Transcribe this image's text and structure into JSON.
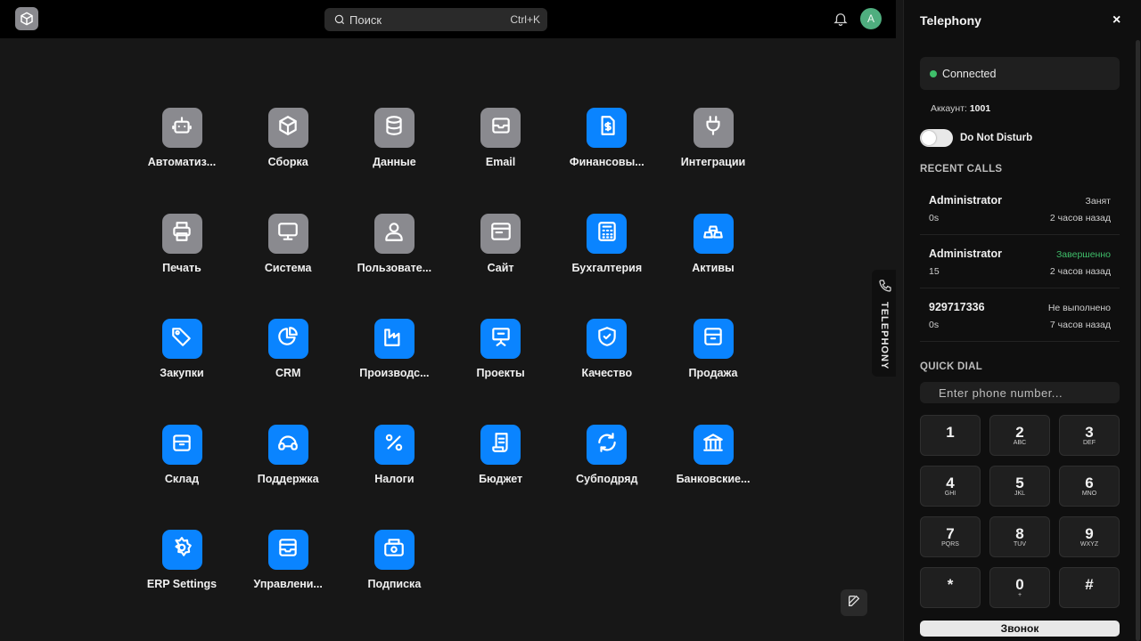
{
  "header": {
    "logo_icon": "cube-logo-icon",
    "search_placeholder": "Поиск",
    "search_shortcut": "Ctrl+K",
    "avatar_initial": "A"
  },
  "apps": [
    {
      "label": "Автоматиз...",
      "icon": "robot-icon",
      "color": "gray"
    },
    {
      "label": "Сборка",
      "icon": "cube-icon",
      "color": "gray"
    },
    {
      "label": "Данные",
      "icon": "database-icon",
      "color": "gray"
    },
    {
      "label": "Email",
      "icon": "mail-icon",
      "color": "gray"
    },
    {
      "label": "Финансовы...",
      "icon": "finance-doc-icon",
      "color": "blue"
    },
    {
      "label": "Интеграции",
      "icon": "plug-icon",
      "color": "gray"
    },
    {
      "label": "Печать",
      "icon": "printer-icon",
      "color": "gray"
    },
    {
      "label": "Система",
      "icon": "monitor-icon",
      "color": "gray"
    },
    {
      "label": "Пользовате...",
      "icon": "user-icon",
      "color": "gray"
    },
    {
      "label": "Сайт",
      "icon": "browser-icon",
      "color": "gray"
    },
    {
      "label": "Бухгалтерия",
      "icon": "calculator-icon",
      "color": "blue"
    },
    {
      "label": "Активы",
      "icon": "gold-bars-icon",
      "color": "blue"
    },
    {
      "label": "Закупки",
      "icon": "tag-icon",
      "color": "blue"
    },
    {
      "label": "CRM",
      "icon": "pie-chart-icon",
      "color": "blue"
    },
    {
      "label": "Производс...",
      "icon": "factory-icon",
      "color": "blue"
    },
    {
      "label": "Проекты",
      "icon": "presentation-icon",
      "color": "blue"
    },
    {
      "label": "Качество",
      "icon": "shield-check-icon",
      "color": "blue"
    },
    {
      "label": "Продажа",
      "icon": "archive-icon",
      "color": "blue"
    },
    {
      "label": "Склад",
      "icon": "warehouse-box-icon",
      "color": "blue"
    },
    {
      "label": "Поддержка",
      "icon": "headset-icon",
      "color": "blue"
    },
    {
      "label": "Налоги",
      "icon": "percent-icon",
      "color": "blue"
    },
    {
      "label": "Бюджет",
      "icon": "scroll-icon",
      "color": "blue"
    },
    {
      "label": "Субподряд",
      "icon": "refresh-icon",
      "color": "blue"
    },
    {
      "label": "Банковские...",
      "icon": "bank-icon",
      "color": "blue"
    },
    {
      "label": "ERP Settings",
      "icon": "gear-icon",
      "color": "blue"
    },
    {
      "label": "Управлени...",
      "icon": "inbox-icon",
      "color": "blue"
    },
    {
      "label": "Подписка",
      "icon": "subscription-icon",
      "color": "blue"
    }
  ],
  "side_tab": {
    "label": "TELEPHONY",
    "icon": "phone-icon"
  },
  "telephony": {
    "title": "Telephony",
    "close_label": "×",
    "status": "Connected",
    "account_label": "Аккаунт:",
    "account_value": "1001",
    "dnd_label": "Do Not Disturb",
    "dnd_on": false,
    "recent_title": "RECENT CALLS",
    "recent_calls": [
      {
        "number": "Administrator",
        "status": "Занят",
        "duration": "0s",
        "time": "2 часов назад"
      },
      {
        "number": "Administrator",
        "status": "Завершенно",
        "duration": "15",
        "time": "2 часов назад"
      },
      {
        "number": "929717336",
        "status": "Не выполнено",
        "duration": "0s",
        "time": "7 часов назад"
      }
    ],
    "quick_dial_title": "QUICK DIAL",
    "phone_placeholder": "Enter phone number...",
    "keys": [
      {
        "d": "1",
        "s": ""
      },
      {
        "d": "2",
        "s": "ABC"
      },
      {
        "d": "3",
        "s": "DEF"
      },
      {
        "d": "4",
        "s": "GHI"
      },
      {
        "d": "5",
        "s": "JKL"
      },
      {
        "d": "6",
        "s": "MNO"
      },
      {
        "d": "7",
        "s": "PQRS"
      },
      {
        "d": "8",
        "s": "TUV"
      },
      {
        "d": "9",
        "s": "WXYZ"
      },
      {
        "d": "*",
        "s": ""
      },
      {
        "d": "0",
        "s": "+"
      },
      {
        "d": "#",
        "s": ""
      }
    ],
    "call_button": "Звонок"
  },
  "colors": {
    "accent": "#0a84ff",
    "tile_gray": "#8a8a8f",
    "connected": "#3fbf6a",
    "avatar": "#4fae7f"
  }
}
